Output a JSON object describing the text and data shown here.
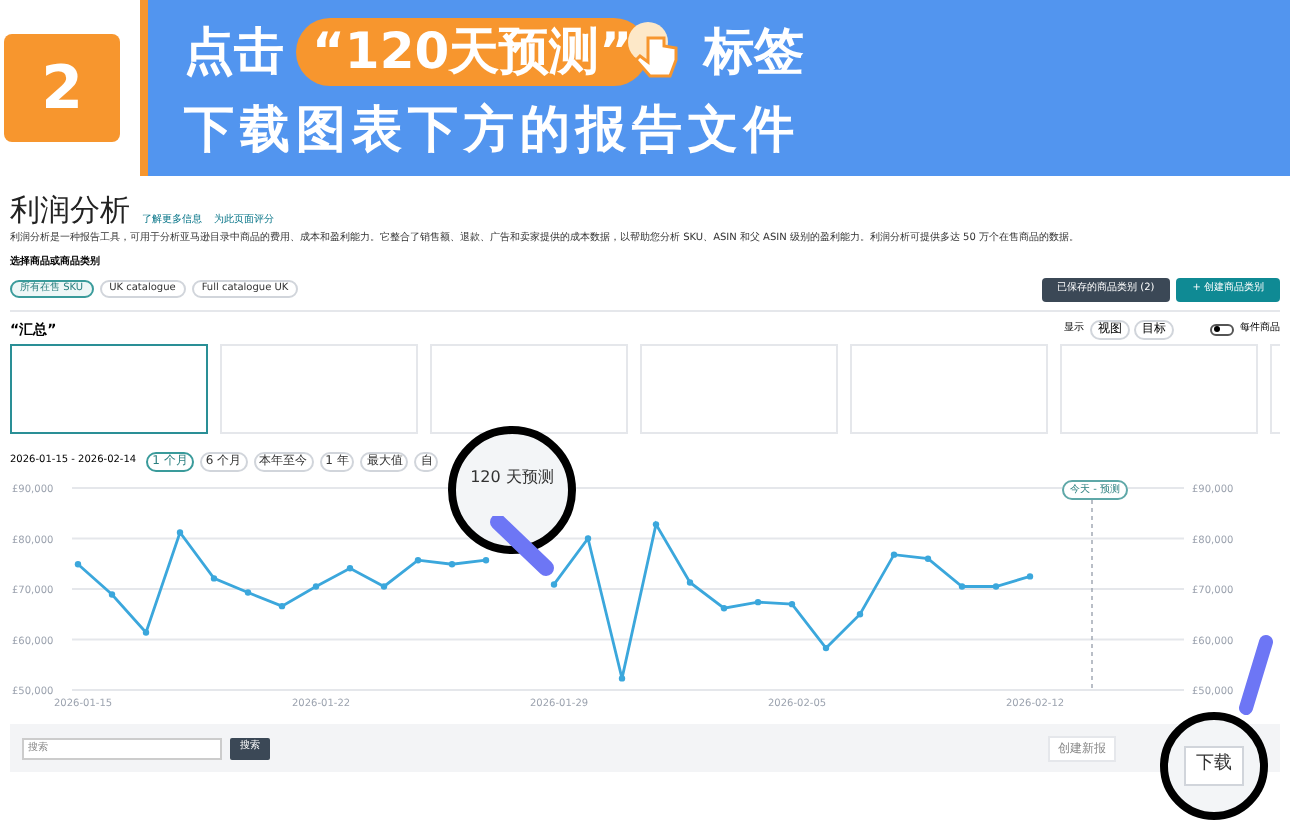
{
  "banner": {
    "step": "2",
    "line1_before": "点击",
    "highlight": "“120天预测”",
    "line1_after": "标签",
    "line2": "下载图表下方的报告文件"
  },
  "header": {
    "title": "利润分析",
    "links": [
      "了解更多信息",
      "为此页面评分"
    ],
    "description": "利润分析是一种报告工具，可用于分析亚马逊目录中商品的费用、成本和盈利能力。它整合了销售额、退款、广告和卖家提供的成本数据，以帮助您分析 SKU、ASIN 和父 ASIN 级别的盈利能力。利润分析可提供多达 50 万个在售商品的数据。"
  },
  "selector": {
    "label": "选择商品或商品类别",
    "chips": [
      {
        "label": "所有在售 SKU",
        "selected": true
      },
      {
        "label": "UK catalogue",
        "selected": false
      },
      {
        "label": "Full catalogue UK",
        "selected": false
      }
    ],
    "buttons": [
      {
        "label": "已保存的商品类别 (2)",
        "kind": "dark"
      },
      {
        "label": "+ 创建商品类别",
        "kind": "teal"
      }
    ]
  },
  "summary": {
    "title": "“汇总”",
    "display_label": "显示",
    "display_options": [
      "视图",
      "目标"
    ],
    "per_item": {
      "label": "每件商品",
      "on": false
    },
    "cards": [
      {
        "selected": true
      },
      {
        "selected": false
      },
      {
        "selected": false
      },
      {
        "selected": false
      },
      {
        "selected": false
      },
      {
        "selected": false
      },
      {
        "selected": false
      }
    ]
  },
  "range": {
    "dates": "2026-01-15 - 2026-02-14",
    "options": [
      {
        "label": "1 个月",
        "selected": true
      },
      {
        "label": "6 个月",
        "selected": false
      },
      {
        "label": "本年至今",
        "selected": false
      },
      {
        "label": "1 年",
        "selected": false
      },
      {
        "label": "最大值",
        "selected": false
      },
      {
        "label": "自",
        "selected": false
      }
    ],
    "magnified_tab": "120 天预测"
  },
  "chart": {
    "today_label": "今天 - 预测",
    "chart_data": {
      "type": "line",
      "categories": [
        "2026-01-15",
        null,
        null,
        null,
        null,
        null,
        null,
        "2026-01-22",
        null,
        null,
        null,
        null,
        null,
        null,
        "2026-01-29",
        null,
        null,
        null,
        null,
        null,
        null,
        "2026-02-05",
        null,
        null,
        null,
        null,
        null,
        null,
        "2026-02-12"
      ],
      "grid": true,
      "series": [
        {
          "color": "#3ba7dc",
          "marker": true,
          "values": [
            74900,
            68900,
            61400,
            81200,
            72100,
            69300,
            66600,
            70500,
            74100,
            70500,
            75700,
            74900,
            75700,
            null,
            70900,
            80000,
            52300,
            82800,
            71300,
            66200,
            67400,
            67000,
            58300,
            65000,
            76800,
            76000,
            70500,
            70500,
            72500
          ]
        }
      ],
      "ylim": [
        50000,
        90000
      ],
      "yticks": [
        {
          "value": 90000,
          "label": "£90,000"
        },
        {
          "value": 80000,
          "label": "£80,000"
        },
        {
          "value": 70000,
          "label": "£70,000"
        },
        {
          "value": 60000,
          "label": "£60,000"
        },
        {
          "value": 50000,
          "label": "£50,000"
        }
      ]
    }
  },
  "footer": {
    "search_placeholder": "搜索",
    "search_button": "搜索",
    "create_report": "创建新报",
    "download": "下载"
  }
}
